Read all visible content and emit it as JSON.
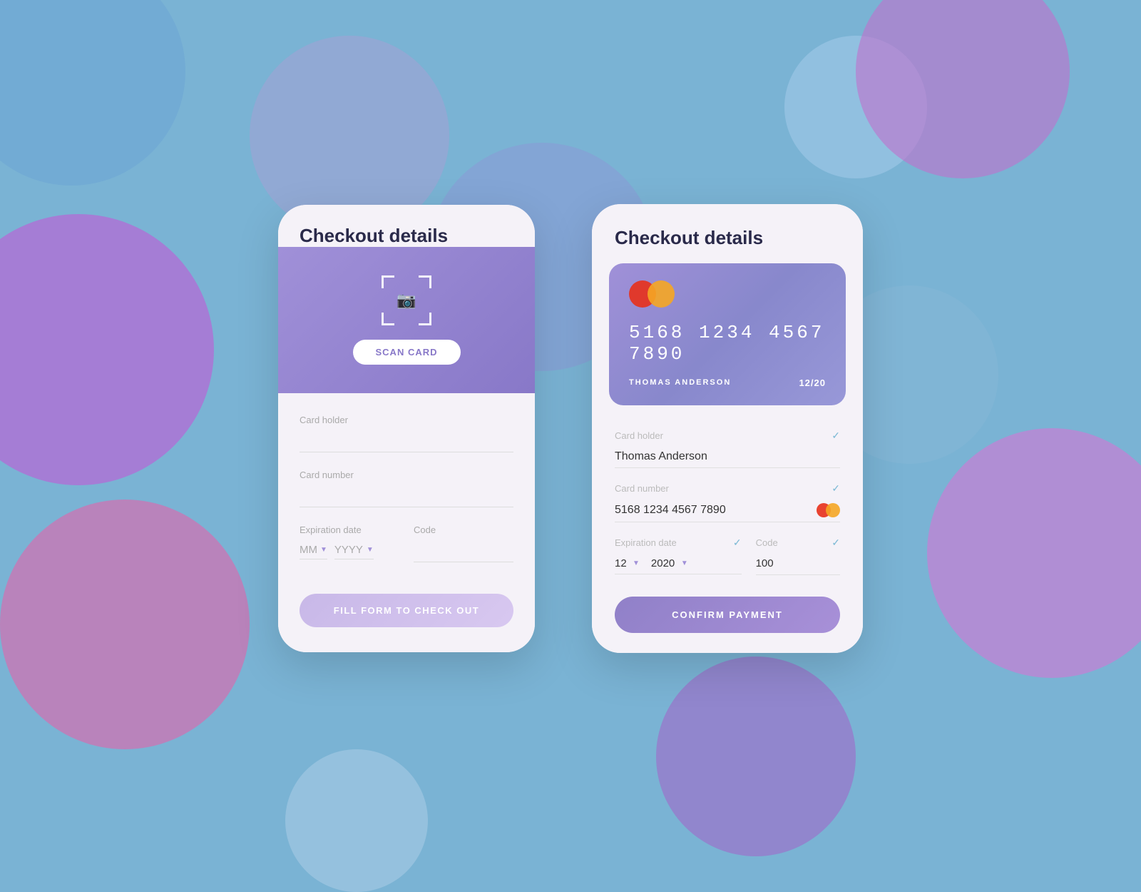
{
  "background": {
    "color": "#7ab3d4"
  },
  "left_phone": {
    "title": "Checkout details",
    "scan_button": "SCAN CARD",
    "fields": {
      "card_holder": {
        "label": "Card holder",
        "placeholder": "",
        "value": ""
      },
      "card_number": {
        "label": "Card number",
        "placeholder": "",
        "value": ""
      },
      "expiration_date": {
        "label": "Expiration date",
        "mm_placeholder": "MM",
        "yyyy_placeholder": "YYYY"
      },
      "code": {
        "label": "Code"
      }
    },
    "cta_button": "FILL FORM TO CHECK OUT"
  },
  "right_phone": {
    "title": "Checkout details",
    "card": {
      "number": "5168  1234  4567  7890",
      "holder": "THOMAS ANDERSON",
      "expiry": "12/20"
    },
    "fields": {
      "card_holder": {
        "label": "Card holder",
        "value": "Thomas Anderson"
      },
      "card_number": {
        "label": "Card number",
        "value": "5168    1234    4567    7890"
      },
      "expiration_date": {
        "label": "Expiration date",
        "month_value": "12",
        "year_value": "2020"
      },
      "code": {
        "label": "Code",
        "value": "100"
      }
    },
    "confirm_button": "CONFIRM PAYMENT"
  }
}
